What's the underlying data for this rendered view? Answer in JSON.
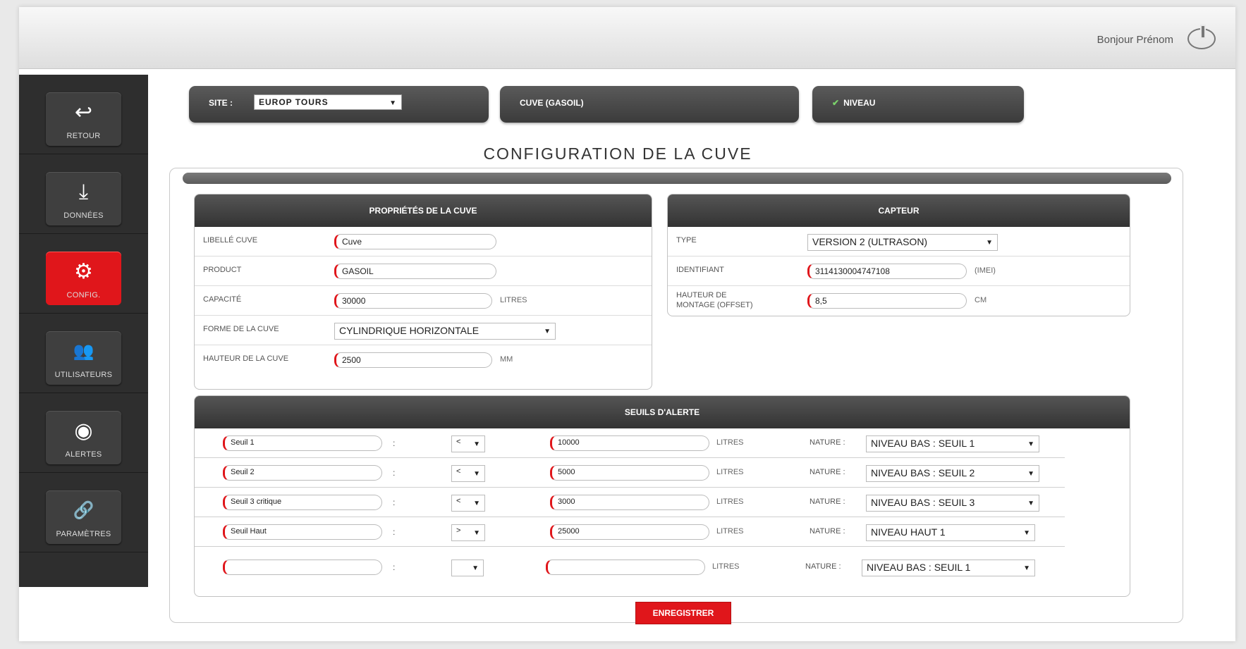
{
  "header": {
    "greeting": "Bonjour Prénom",
    "power_icon": "power-icon"
  },
  "sidebar": {
    "items": [
      {
        "label": "RETOUR",
        "icon": "↩",
        "icon_name": "back-arrow-icon",
        "active": false
      },
      {
        "label": "DONNÉES",
        "icon": "⤓",
        "icon_name": "download-icon",
        "active": false
      },
      {
        "label": "CONFIG.",
        "icon": "⚙",
        "icon_name": "gear-icon",
        "active": true
      },
      {
        "label": "UTILISATEURS",
        "icon": "👥",
        "icon_name": "users-icon",
        "active": false
      },
      {
        "label": "ALERTES",
        "icon": "◉",
        "icon_name": "alert-broadcast-icon",
        "active": false
      },
      {
        "label": "PARAMÈTRES",
        "icon": "🔗",
        "icon_name": "link-icon",
        "active": false
      }
    ]
  },
  "top_pills": {
    "site_label": "SITE :",
    "site_value": "EUROP TOURS",
    "cuve_label": "CUVE (GASOIL)",
    "niveau_label": "NIVEAU"
  },
  "page_title": "CONFIGURATION DE LA CUVE",
  "properties": {
    "title": "PROPRIÉTÉS DE LA CUVE",
    "libelle_label": "LIBELLÉ CUVE",
    "libelle_value": "Cuve",
    "product_label": "PRODUCT",
    "product_value": "GASOIL",
    "capacite_label": "CAPACITÉ",
    "capacite_value": "30000",
    "capacite_unit": "LITRES",
    "forme_label": "FORME DE LA CUVE",
    "forme_value": "CYLINDRIQUE HORIZONTALE",
    "hauteur_label": "HAUTEUR DE LA CUVE",
    "hauteur_value": "2500",
    "hauteur_unit": "MM"
  },
  "capteur": {
    "title": "CAPTEUR",
    "type_label": "TYPE",
    "type_value": "VERSION 2 (ULTRASON)",
    "identifiant_label": "IDENTIFIANT",
    "identifiant_value": "3114130004747108",
    "identifiant_unit": "(IMEI)",
    "hauteur_label_1": "HAUTEUR DE",
    "hauteur_label_2": "MONTAGE (OFFSET)",
    "hauteur_value": "8,5",
    "hauteur_unit": "CM"
  },
  "seuils": {
    "title": "SEUILS D'ALERTE",
    "colon": ":",
    "unit": "LITRES",
    "nature_label": "NATURE :",
    "rows": [
      {
        "name": "Seuil 1",
        "op": "<",
        "value": "10000",
        "nature": "NIVEAU BAS : SEUIL 1"
      },
      {
        "name": "Seuil 2",
        "op": "<",
        "value": "5000",
        "nature": "NIVEAU BAS : SEUIL 2"
      },
      {
        "name": "Seuil 3 critique",
        "op": "<",
        "value": "3000",
        "nature": "NIVEAU BAS : SEUIL 3"
      },
      {
        "name": "Seuil Haut",
        "op": ">",
        "value": "25000",
        "nature": "NIVEAU HAUT 1"
      },
      {
        "name": "",
        "op": "",
        "value": "",
        "nature": "NIVEAU BAS : SEUIL 1"
      }
    ]
  },
  "save_label": "ENREGISTRER"
}
